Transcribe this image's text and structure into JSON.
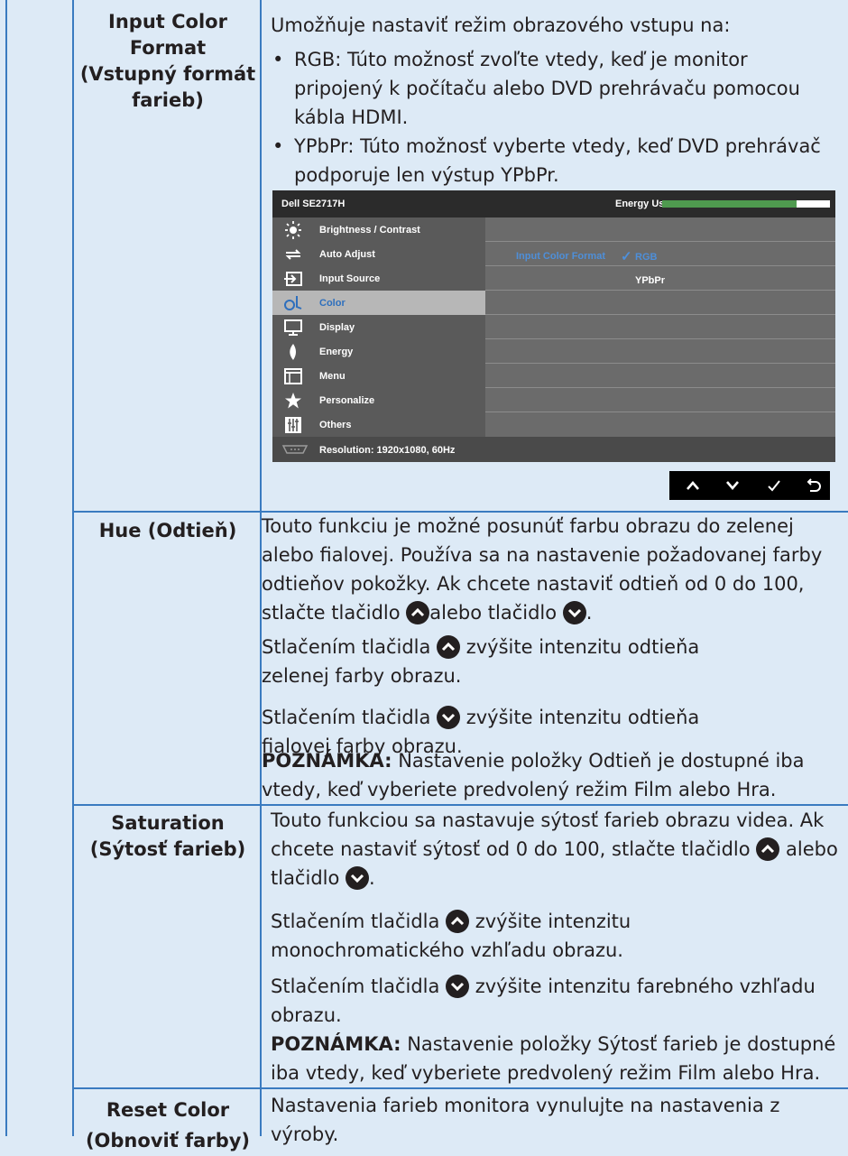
{
  "rows": {
    "input_color_format": {
      "label": "Input Color Format (Vstupný formát farieb)",
      "intro": "Umožňuje nastaviť režim obrazového vstupu na:",
      "bullets": [
        "RGB: Túto možnosť zvoľte vtedy, keď je monitor pripojený k počítaču alebo DVD prehrávaču pomocou kábla HDMI.",
        "YPbPr: Túto možnosť vyberte vtedy, keď DVD prehrávač podporuje len výstup YPbPr."
      ]
    },
    "hue": {
      "label": "Hue (Odtieň)",
      "p1a": "Touto funkciu je možné posunúť farbu obrazu do zelenej alebo fialovej. Používa sa na nastavenie požadovanej farby odtieňov pokožky. Ak chcete nastaviť odtieň od 0 do 100, stlačte tlačidlo",
      "p1b": "alebo tlačidlo",
      "p1c": ".",
      "p2a": "Stlačením tlačidla",
      "p2b": "zvýšite intenzitu odtieňa zelenej farby obrazu.",
      "p3a": "Stlačením tlačidla",
      "p3b": "zvýšite intenzitu odtieňa fialovej farby obrazu.",
      "note_label": "POZNÁMKA:",
      "note_text": "Nastavenie položky Odtieň je dostupné iba vtedy, keď vyberiete predvolený režim Film alebo Hra."
    },
    "saturation": {
      "label": "Saturation (Sýtosť farieb)",
      "p1a": "Touto funkciou sa nastavuje sýtosť farieb obrazu videa. Ak chcete nastaviť sýtosť od 0 do 100, stlačte tlačidlo",
      "p1b": "alebo tlačidlo",
      "p1c": ".",
      "p2a": "Stlačením tlačidla",
      "p2b": "zvýšite intenzitu monochromatického vzhľadu obrazu.",
      "p3a": "Stlačením tlačidla",
      "p3b": "zvýšite intenzitu farebného vzhľadu obrazu.",
      "note_label": "POZNÁMKA:",
      "note_text": "Nastavenie položky Sýtosť farieb je dostupné iba vtedy, keď vyberiete predvolený režim Film alebo Hra."
    },
    "reset_color": {
      "label": "Reset Color (Obnoviť farby)",
      "text": "Nastavenia farieb monitora vynulujte na nastavenia z výroby."
    }
  },
  "osd": {
    "model": "Dell SE2717H",
    "energy_label": "Energy Use",
    "energy_level": 0.8,
    "menu": [
      {
        "label": "Brightness / Contrast",
        "icon": "brightness-icon",
        "selected": false
      },
      {
        "label": "Auto Adjust",
        "icon": "auto-adjust-icon",
        "selected": false
      },
      {
        "label": "Input Source",
        "icon": "input-source-icon",
        "selected": false
      },
      {
        "label": "Color",
        "icon": "color-icon",
        "selected": true
      },
      {
        "label": "Display",
        "icon": "display-icon",
        "selected": false
      },
      {
        "label": "Energy",
        "icon": "energy-icon",
        "selected": false
      },
      {
        "label": "Menu",
        "icon": "menu-icon",
        "selected": false
      },
      {
        "label": "Personalize",
        "icon": "personalize-icon",
        "selected": false
      },
      {
        "label": "Others",
        "icon": "others-icon",
        "selected": false
      }
    ],
    "setting_label": "Input Color Format",
    "check_mark": "✓",
    "options": [
      "RGB",
      "YPbPr"
    ],
    "selected_option": "RGB",
    "resolution": "Resolution: 1920x1080, 60Hz",
    "nav_buttons": [
      "up-icon",
      "down-icon",
      "check-icon",
      "back-icon"
    ],
    "colors": {
      "accent": "#2e6fbd",
      "energy_bar": "#4f9a4f",
      "border": "#3a7bc0"
    }
  }
}
